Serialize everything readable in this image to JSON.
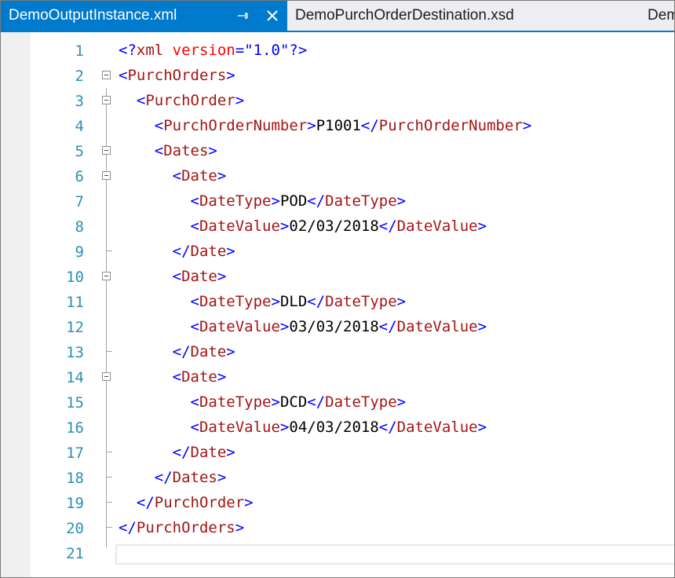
{
  "tabs": [
    {
      "name": "DemoOutputInstance.xml",
      "active": true
    },
    {
      "name": "DemoPurchOrderDestination.xsd",
      "active": false
    },
    {
      "name": "Demo",
      "active": false
    }
  ],
  "icons": {
    "pin": "pin-icon",
    "close": "close-icon"
  },
  "colors": {
    "accent": "#007acc",
    "line_number": "#2b91af",
    "xml_delimiter": "#0000ff",
    "xml_tag": "#a31515",
    "xml_attribute": "#ff0000",
    "text": "#000000"
  },
  "editor": {
    "lines": [
      {
        "num": "1"
      },
      {
        "num": "2"
      },
      {
        "num": "3"
      },
      {
        "num": "4"
      },
      {
        "num": "5"
      },
      {
        "num": "6"
      },
      {
        "num": "7"
      },
      {
        "num": "8"
      },
      {
        "num": "9"
      },
      {
        "num": "10"
      },
      {
        "num": "11"
      },
      {
        "num": "12"
      },
      {
        "num": "13"
      },
      {
        "num": "14"
      },
      {
        "num": "15"
      },
      {
        "num": "16"
      },
      {
        "num": "17"
      },
      {
        "num": "18"
      },
      {
        "num": "19"
      },
      {
        "num": "20"
      },
      {
        "num": "21"
      }
    ],
    "code": {
      "l1_open": "<?",
      "l1_name": "xml",
      "l1_attr": " version",
      "l1_eq": "=",
      "l1_val": "\"1.0\"",
      "l1_close": "?>",
      "purch_orders": "PurchOrders",
      "purch_order": "PurchOrder",
      "purch_order_number": "PurchOrderNumber",
      "purch_order_number_value": "P1001",
      "dates": "Dates",
      "date": "Date",
      "date_type": "DateType",
      "date_value": "DateValue",
      "d1_type": "POD",
      "d1_value": "02/03/2018",
      "d2_type": "DLD",
      "d2_value": "03/03/2018",
      "d3_type": "DCD",
      "d3_value": "04/03/2018",
      "lt": "<",
      "gt": ">",
      "lt_slash": "</"
    }
  }
}
